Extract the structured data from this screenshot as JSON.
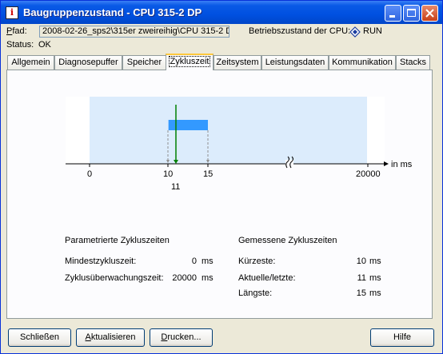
{
  "window": {
    "title": "Baugruppenzustand - CPU 315-2 DP",
    "app_icon_glyph": "i"
  },
  "info": {
    "path_label_prefix": "P",
    "path_label_rest": "fad:",
    "path_value": "2008-02-26_sps2\\315er zweireihig\\CPU 315-2 D",
    "operating_state_label": "Betriebszustand der CPU:",
    "operating_state_value": "RUN",
    "status_label": "Status:",
    "status_value": "OK"
  },
  "tabs": [
    {
      "label": "Allgemein",
      "active": false
    },
    {
      "label": "Diagnosepuffer",
      "active": false
    },
    {
      "label": "Speicher",
      "active": false
    },
    {
      "label": "Zykluszeit",
      "active": true
    },
    {
      "label": "Zeitsystem",
      "active": false
    },
    {
      "label": "Leistungsdaten",
      "active": false
    },
    {
      "label": "Kommunikation",
      "active": false
    },
    {
      "label": "Stacks",
      "active": false
    }
  ],
  "chart_data": {
    "type": "bar",
    "axis_unit": "in ms",
    "ticks": [
      "0",
      "10",
      "15",
      "20000"
    ],
    "current_label": "11",
    "min_ms": 10,
    "current_ms": 11,
    "max_ms": 15,
    "axis_break": true,
    "colors": {
      "range_bar": "#3399ff",
      "current_line": "#008000",
      "monitor_zone": "#dcecfc"
    }
  },
  "parametrized": {
    "heading": "Parametrierte Zykluszeiten",
    "rows": [
      {
        "label": "Mindestzykluszeit:",
        "value": "0",
        "unit": "ms"
      },
      {
        "label": "Zyklusüberwachungszeit:",
        "value": "20000",
        "unit": "ms"
      }
    ]
  },
  "measured": {
    "heading": "Gemessene Zykluszeiten",
    "rows": [
      {
        "label": "Kürzeste:",
        "value": "10",
        "unit": "ms"
      },
      {
        "label": "Aktuelle/letzte:",
        "value": "11",
        "unit": "ms"
      },
      {
        "label": "Längste:",
        "value": "15",
        "unit": "ms"
      }
    ]
  },
  "buttons": {
    "close": "Schließen",
    "refresh_prefix": "A",
    "refresh_rest": "ktualisieren",
    "print_prefix": "D",
    "print_rest": "rucken...",
    "help": "Hilfe"
  }
}
